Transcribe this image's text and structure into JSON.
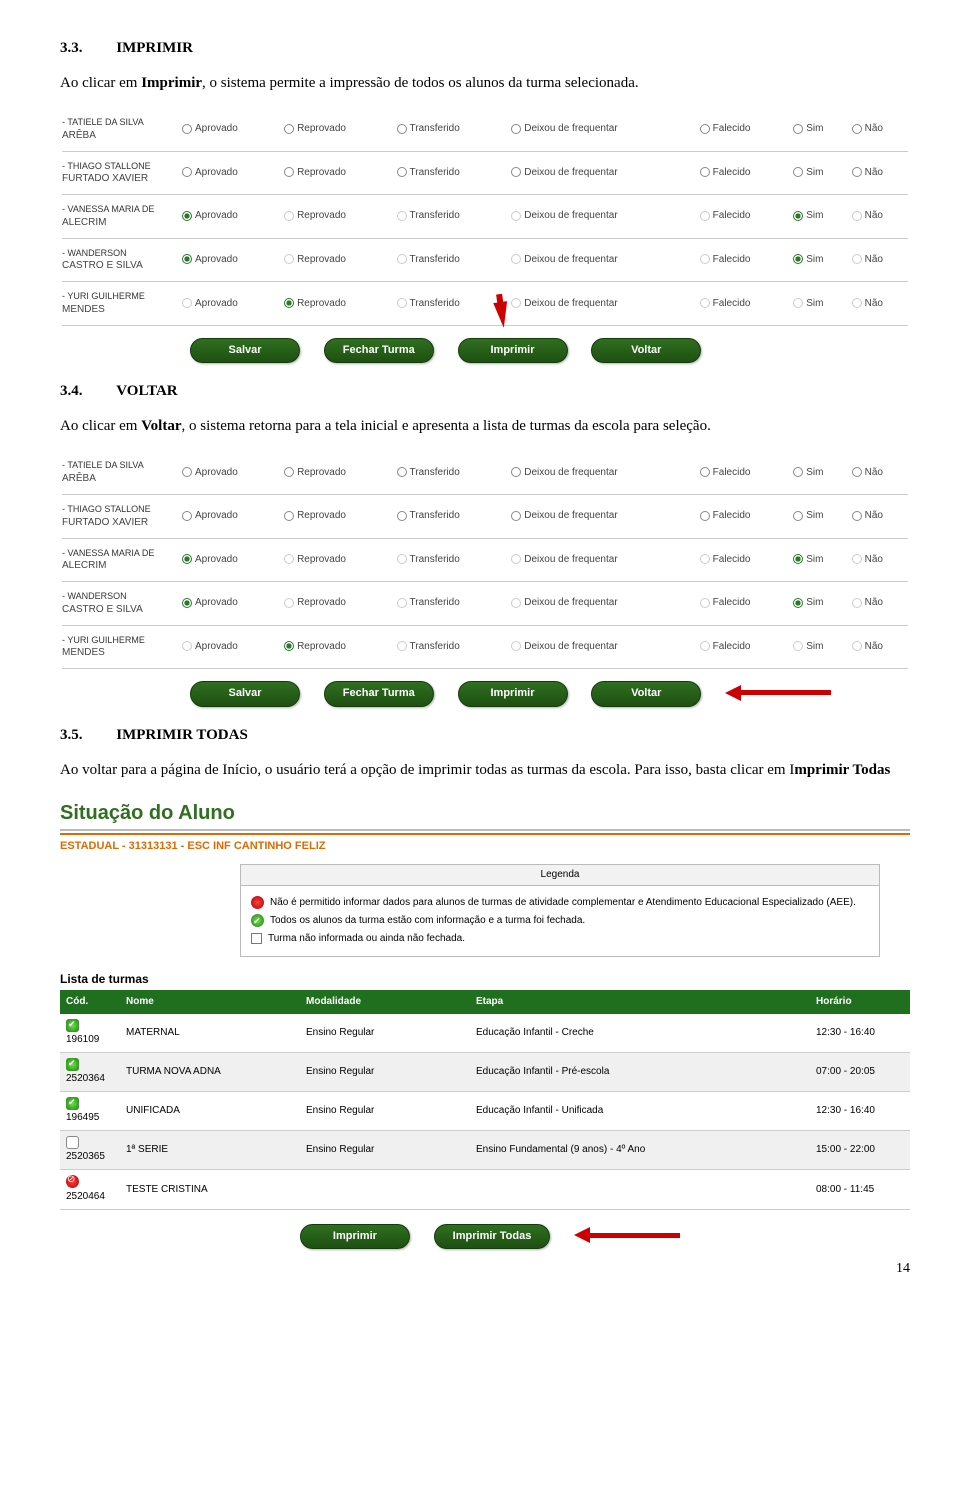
{
  "s33": {
    "num": "3.3.",
    "title": "IMPRIMIR",
    "para_pre": "Ao clicar em ",
    "para_bold": "Imprimir",
    "para_post": ", o sistema permite a impressão de todos os alunos da turma selecionada."
  },
  "s34": {
    "num": "3.4.",
    "title": "VOLTAR",
    "para_pre": "Ao clicar em ",
    "para_bold": "Voltar",
    "para_post": ", o sistema retorna para a tela inicial e apresenta a lista de turmas da escola para seleção."
  },
  "s35": {
    "num": "3.5.",
    "title": "IMPRIMIR TODAS",
    "para1": "Ao voltar para a página de Início, o usuário terá a opção de imprimir todas as turmas da escola. Para isso, basta clicar em I",
    "para1_bold": "mprimir Todas"
  },
  "opts": {
    "aprov": "Aprovado",
    "reprov": "Reprovado",
    "transf": "Transferido",
    "deixou": "Deixou de frequentar",
    "falec": "Falecido",
    "sim": "Sim",
    "nao": "Não"
  },
  "students": [
    {
      "l1": "ARÊBA",
      "l2": "- TATIELE DA SILVA",
      "sel": "",
      "sim": "",
      "dim": false
    },
    {
      "l1": "FURTADO XAVIER",
      "l2": "- THIAGO STALLONE",
      "sel": "",
      "sim": "",
      "dim": false
    },
    {
      "l1": "ALECRIM",
      "l2": "- VANESSA MARIA DE",
      "sel": "aprov",
      "sim": "sim",
      "dim": true
    },
    {
      "l1": "CASTRO E SILVA",
      "l2": "- WANDERSON",
      "sel": "aprov",
      "sim": "sim",
      "dim": true
    },
    {
      "l1": "MENDES",
      "l2": "- YURI GUILHERME",
      "sel": "reprov",
      "sim": "",
      "dim": true
    }
  ],
  "btns": {
    "salvar": "Salvar",
    "fechar": "Fechar Turma",
    "imprimir": "Imprimir",
    "voltar": "Voltar",
    "imprimir_todas": "Imprimir Todas"
  },
  "situ": {
    "title": "Situação do Aluno",
    "estadual": "ESTADUAL - 31313131 - ESC INF CANTINHO FELIZ",
    "legend_head": "Legenda",
    "legend_red": "Não é permitido informar dados para alunos de turmas de atividade complementar e Atendimento Educacional Especializado (AEE).",
    "legend_green": "Todos os alunos da turma estão com informação e a turma foi fechada.",
    "legend_box": "Turma não informada ou ainda não fechada.",
    "lista": "Lista de turmas",
    "cols": {
      "cod": "Cód.",
      "nome": "Nome",
      "mod": "Modalidade",
      "etapa": "Etapa",
      "hor": "Horário"
    },
    "rows": [
      {
        "st": "g",
        "cod": "196109",
        "nome": "MATERNAL",
        "mod": "Ensino Regular",
        "etapa": "Educação Infantil - Creche",
        "hor": "12:30 - 16:40"
      },
      {
        "st": "g",
        "cod": "2520364",
        "nome": "TURMA NOVA ADNA",
        "mod": "Ensino Regular",
        "etapa": "Educação Infantil - Pré-escola",
        "hor": "07:00 - 20:05"
      },
      {
        "st": "g",
        "cod": "196495",
        "nome": "UNIFICADA",
        "mod": "Ensino Regular",
        "etapa": "Educação Infantil - Unificada",
        "hor": "12:30 - 16:40"
      },
      {
        "st": "e",
        "cod": "2520365",
        "nome": "1ª SERIE",
        "mod": "Ensino Regular",
        "etapa": "Ensino Fundamental (9 anos) - 4º Ano",
        "hor": "15:00 - 22:00"
      },
      {
        "st": "r",
        "cod": "2520464",
        "nome": "TESTE CRISTINA",
        "mod": "",
        "etapa": "",
        "hor": "08:00 - 11:45"
      }
    ]
  },
  "pagenum": "14"
}
